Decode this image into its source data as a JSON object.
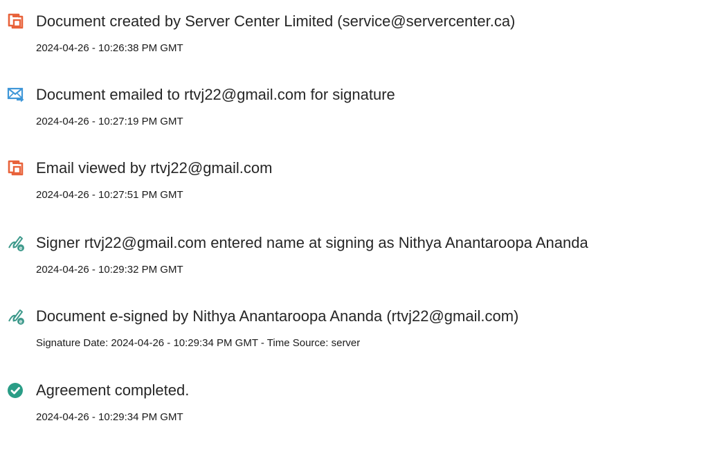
{
  "events": [
    {
      "icon": "document-icon",
      "title": "Document created by Server Center Limited (service@servercenter.ca)",
      "detail": "2024-04-26 - 10:26:38 PM GMT"
    },
    {
      "icon": "email-sent-icon",
      "title": "Document emailed to rtvj22@gmail.com for signature",
      "detail": "2024-04-26 - 10:27:19 PM GMT"
    },
    {
      "icon": "document-icon",
      "title": "Email viewed by rtvj22@gmail.com",
      "detail": "2024-04-26 - 10:27:51 PM GMT"
    },
    {
      "icon": "pen-sign-icon",
      "title": "Signer rtvj22@gmail.com entered name at signing as Nithya Anantaroopa Ananda",
      "detail": "2024-04-26 - 10:29:32 PM GMT"
    },
    {
      "icon": "pen-sign-icon",
      "title": "Document e-signed by Nithya Anantaroopa Ananda (rtvj22@gmail.com)",
      "detail": "Signature Date: 2024-04-26 - 10:29:34 PM GMT - Time Source: server"
    },
    {
      "icon": "check-circle-icon",
      "title": "Agreement completed.",
      "detail": "2024-04-26 - 10:29:34 PM GMT"
    }
  ],
  "colors": {
    "document_icon": "#e8623a",
    "email_icon": "#3f97d8",
    "pen_icon": "#3f9a8c",
    "check_icon": "#2a9d86"
  }
}
